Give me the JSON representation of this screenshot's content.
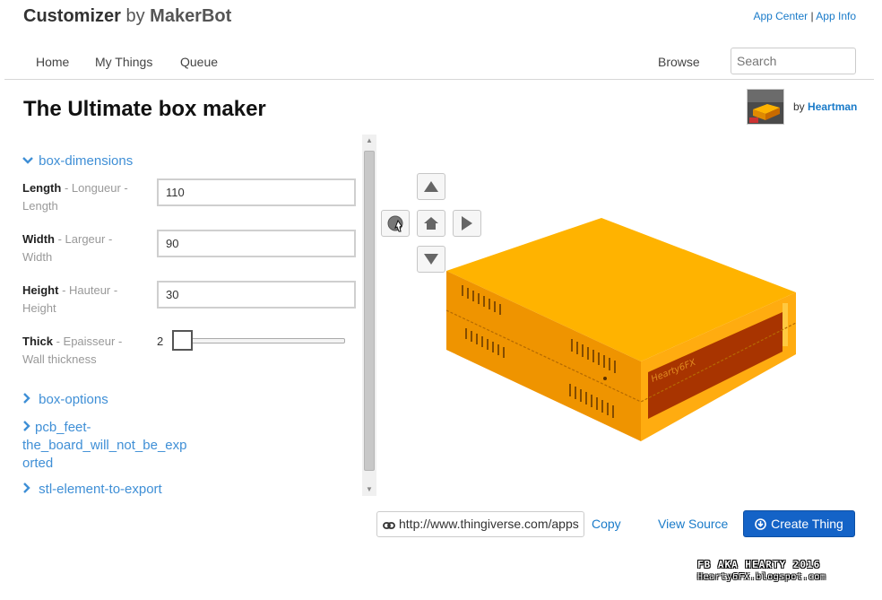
{
  "header": {
    "brand_bold": "Customizer",
    "brand_by": "by",
    "brand_maker": "MakerBot",
    "links": [
      "App Center",
      "App Info"
    ],
    "link_separator": "|"
  },
  "nav": {
    "items": [
      "Home",
      "My Things",
      "Queue"
    ],
    "browse": "Browse",
    "search_placeholder": "Search"
  },
  "thing": {
    "title": "The Ultimate box maker",
    "author_prefix": "by",
    "author_name": "Heartman"
  },
  "params": {
    "section_open": "box-dimensions",
    "fields": [
      {
        "name": "Length",
        "desc_a": " - Longueur -",
        "desc_b": "Length",
        "value": "110"
      },
      {
        "name": "Width",
        "desc_a": " - Largeur -",
        "desc_b": "Width",
        "value": "90"
      },
      {
        "name": "Height",
        "desc_a": " - Hauteur -",
        "desc_b": "Height",
        "value": "30"
      }
    ],
    "thick": {
      "name": "Thick",
      "desc_a": " - Epaisseur -",
      "desc_b": "Wall thickness",
      "value": "2",
      "min": 2,
      "max": 5
    },
    "sections_collapsed": [
      "box-options",
      "pcb_feet-",
      "the_board_will_not_be_exp",
      "orted",
      "stl-element-to-export"
    ]
  },
  "viewer": {
    "box_color": "#ffb300",
    "box_label": "Hearty6FX"
  },
  "footer": {
    "url": "http://www.thingiverse.com/apps",
    "copy": "Copy",
    "view_source": "View Source",
    "create": "Create Thing"
  },
  "watermark": {
    "line1": "FB AKA HEARTY 2016",
    "line2": "Hearty6FX.blogspot.com"
  },
  "colors": {
    "link": "#1a7bc9",
    "primary_button": "#1463c7",
    "section_link": "#3f8fd6"
  }
}
